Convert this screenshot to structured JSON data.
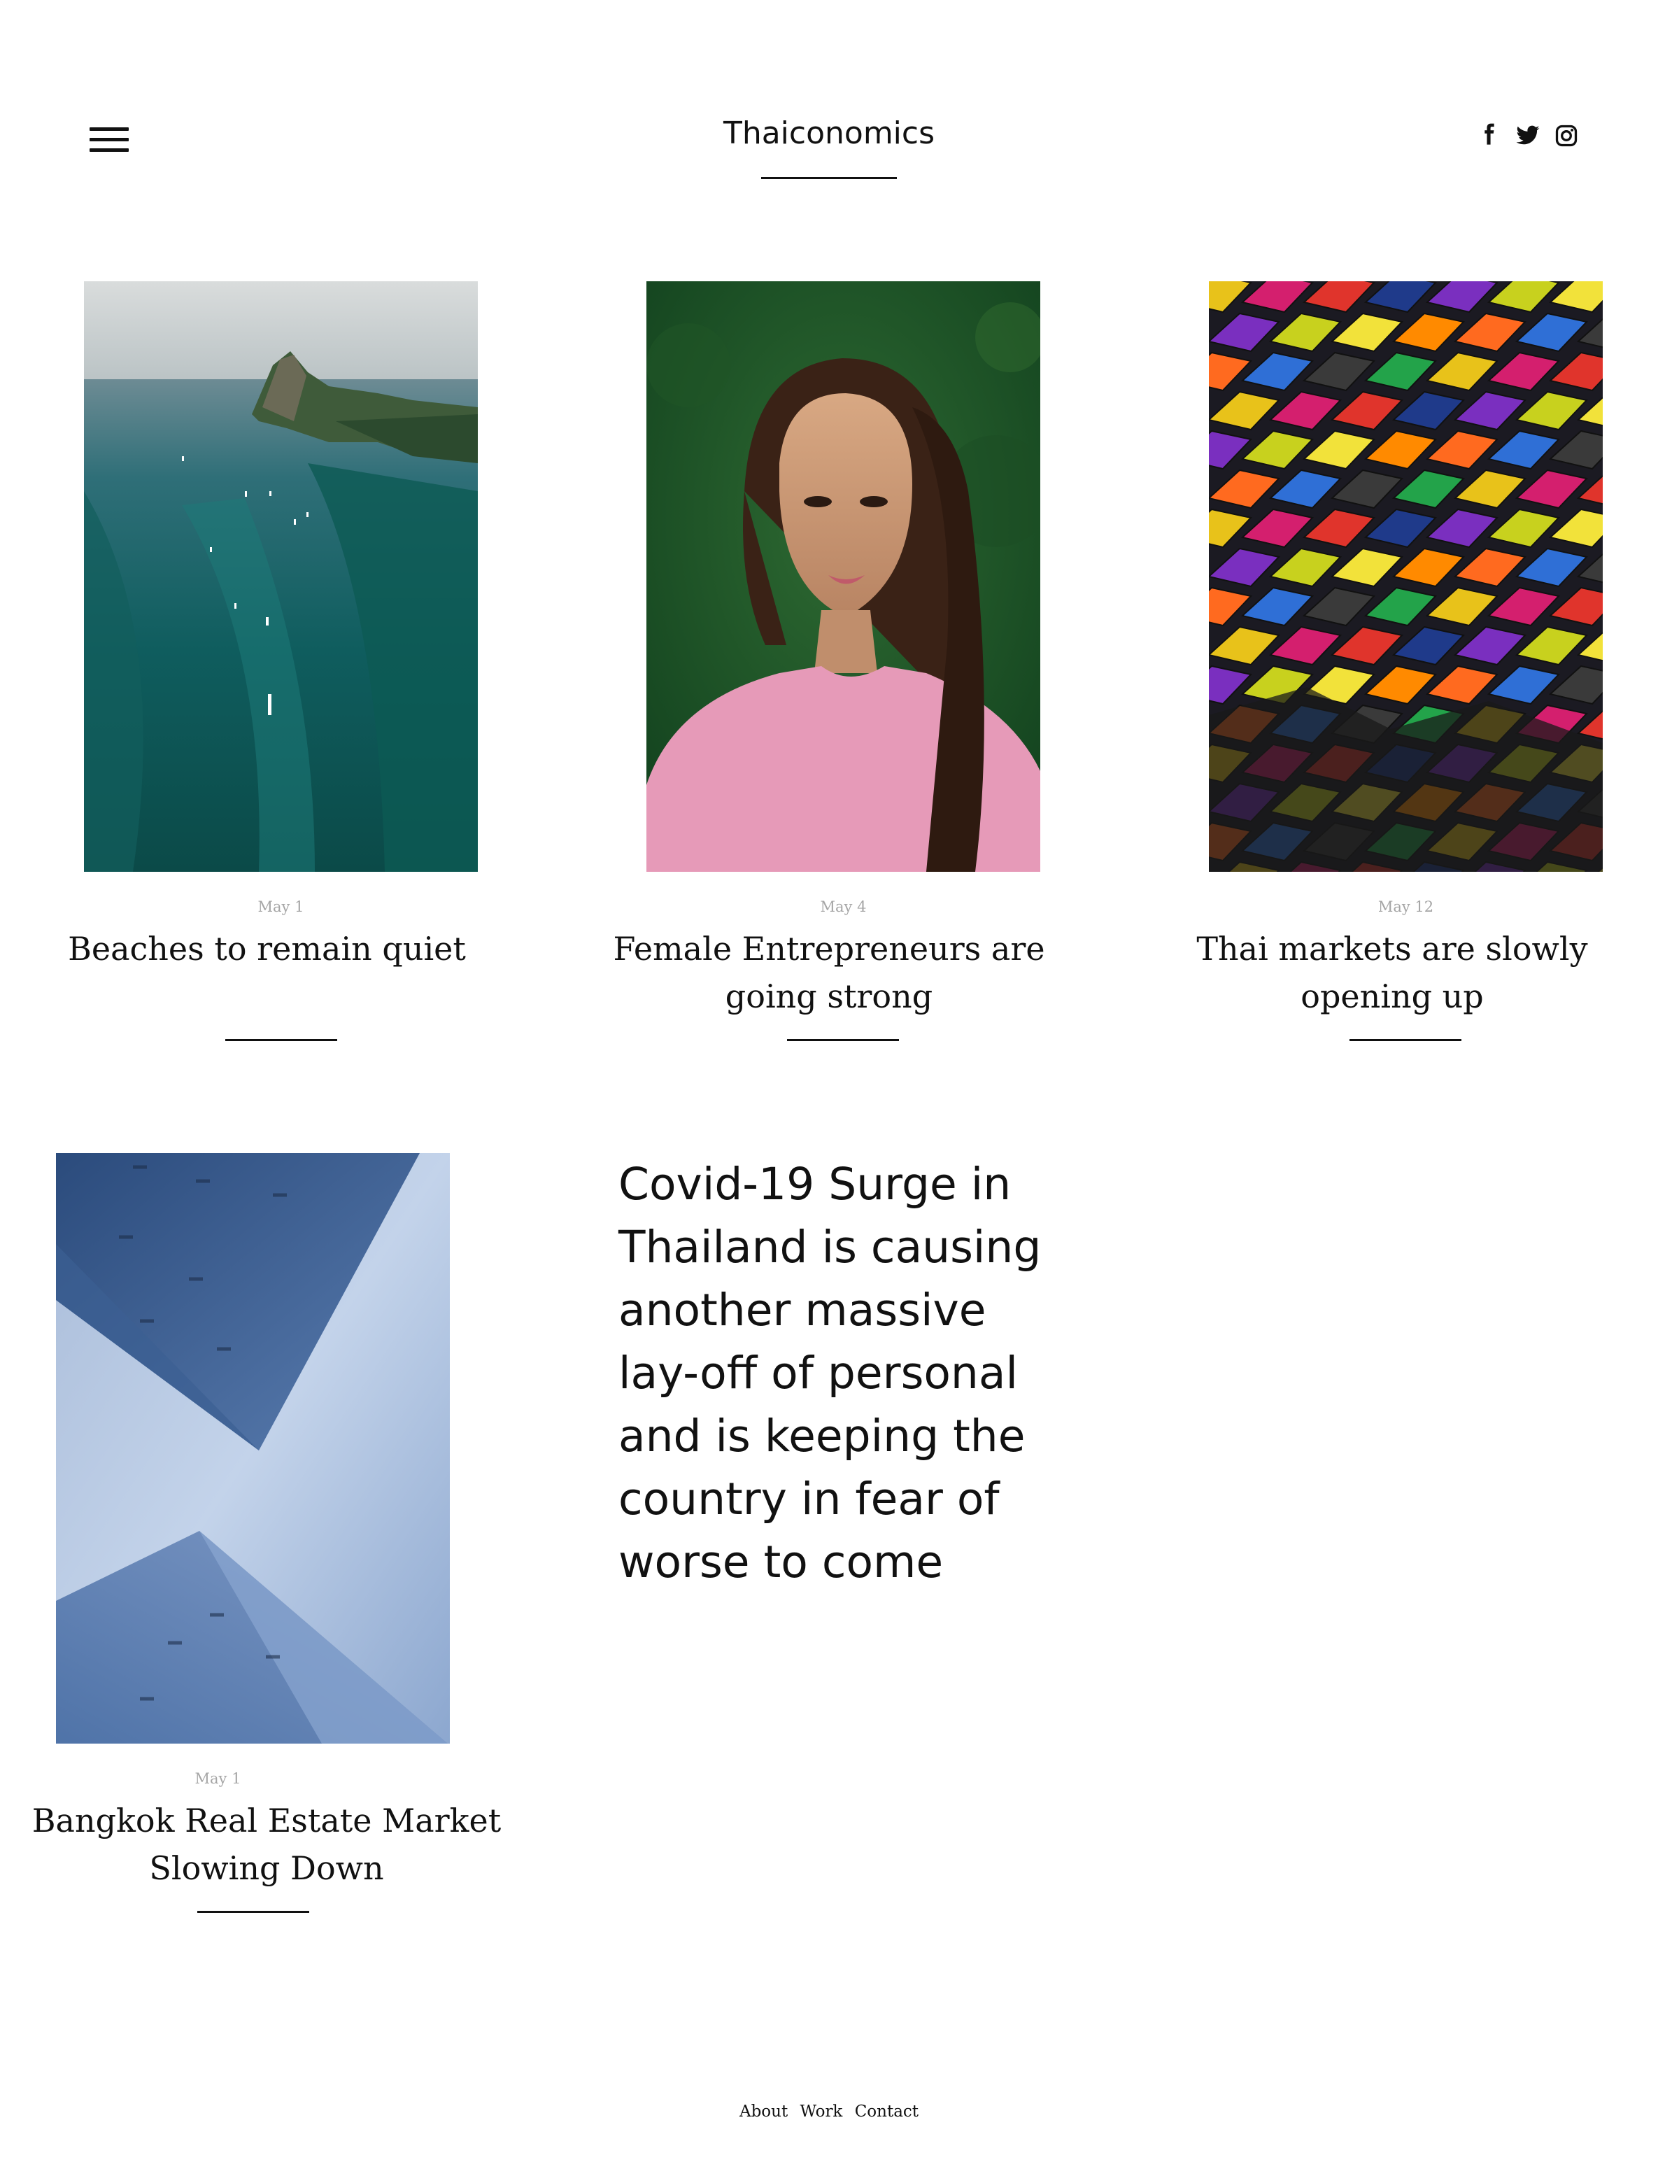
{
  "header": {
    "site_title": "Thaiconomics",
    "menu_icon": "hamburger-menu-icon",
    "social": [
      {
        "name": "facebook",
        "icon": "facebook-icon"
      },
      {
        "name": "twitter",
        "icon": "twitter-icon"
      },
      {
        "name": "instagram",
        "icon": "instagram-icon"
      }
    ]
  },
  "posts": [
    {
      "date": "May 1",
      "title": "Beaches to remain quiet",
      "image": "aerial-sea-island-photo"
    },
    {
      "date": "May 4",
      "title": "Female Entrepreneurs are going strong",
      "image": "woman-portrait-photo"
    },
    {
      "date": "May 12",
      "title": "Thai markets are slowly opening up",
      "image": "night-market-tents-photo"
    },
    {
      "date": "May 1",
      "title": "Bangkok Real Estate Market Slowing Down",
      "image": "skyscrapers-photo"
    }
  ],
  "featured_text": "Covid-19 Surge in Thailand is causing another massive lay-off of personal and is keeping the country in fear of worse to come",
  "footer": {
    "links": [
      "About",
      "Work",
      "Contact"
    ]
  }
}
